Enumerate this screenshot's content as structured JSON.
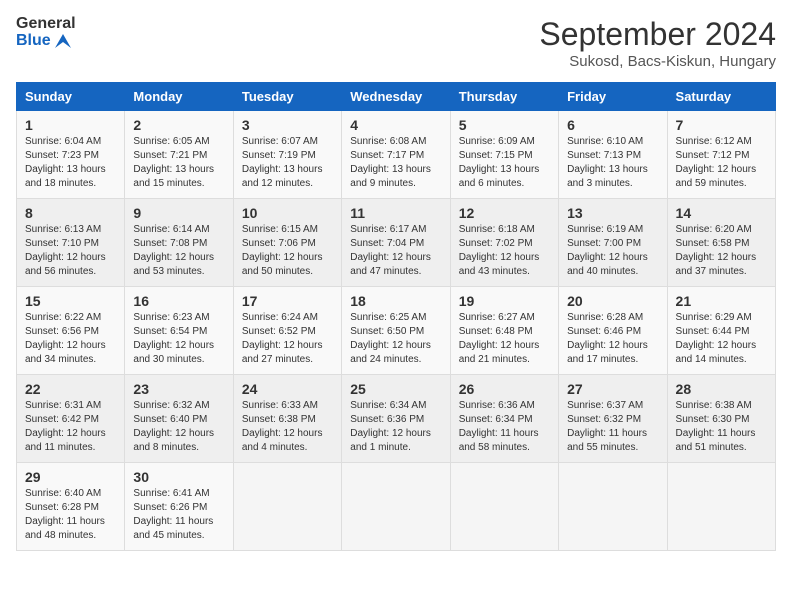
{
  "logo": {
    "line1": "General",
    "line2": "Blue"
  },
  "title": "September 2024",
  "subtitle": "Sukosd, Bacs-Kiskun, Hungary",
  "days_of_week": [
    "Sunday",
    "Monday",
    "Tuesday",
    "Wednesday",
    "Thursday",
    "Friday",
    "Saturday"
  ],
  "weeks": [
    [
      {
        "day": "1",
        "sunrise": "6:04 AM",
        "sunset": "7:23 PM",
        "daylight": "13 hours and 18 minutes."
      },
      {
        "day": "2",
        "sunrise": "6:05 AM",
        "sunset": "7:21 PM",
        "daylight": "13 hours and 15 minutes."
      },
      {
        "day": "3",
        "sunrise": "6:07 AM",
        "sunset": "7:19 PM",
        "daylight": "13 hours and 12 minutes."
      },
      {
        "day": "4",
        "sunrise": "6:08 AM",
        "sunset": "7:17 PM",
        "daylight": "13 hours and 9 minutes."
      },
      {
        "day": "5",
        "sunrise": "6:09 AM",
        "sunset": "7:15 PM",
        "daylight": "13 hours and 6 minutes."
      },
      {
        "day": "6",
        "sunrise": "6:10 AM",
        "sunset": "7:13 PM",
        "daylight": "13 hours and 3 minutes."
      },
      {
        "day": "7",
        "sunrise": "6:12 AM",
        "sunset": "7:12 PM",
        "daylight": "12 hours and 59 minutes."
      }
    ],
    [
      {
        "day": "8",
        "sunrise": "6:13 AM",
        "sunset": "7:10 PM",
        "daylight": "12 hours and 56 minutes."
      },
      {
        "day": "9",
        "sunrise": "6:14 AM",
        "sunset": "7:08 PM",
        "daylight": "12 hours and 53 minutes."
      },
      {
        "day": "10",
        "sunrise": "6:15 AM",
        "sunset": "7:06 PM",
        "daylight": "12 hours and 50 minutes."
      },
      {
        "day": "11",
        "sunrise": "6:17 AM",
        "sunset": "7:04 PM",
        "daylight": "12 hours and 47 minutes."
      },
      {
        "day": "12",
        "sunrise": "6:18 AM",
        "sunset": "7:02 PM",
        "daylight": "12 hours and 43 minutes."
      },
      {
        "day": "13",
        "sunrise": "6:19 AM",
        "sunset": "7:00 PM",
        "daylight": "12 hours and 40 minutes."
      },
      {
        "day": "14",
        "sunrise": "6:20 AM",
        "sunset": "6:58 PM",
        "daylight": "12 hours and 37 minutes."
      }
    ],
    [
      {
        "day": "15",
        "sunrise": "6:22 AM",
        "sunset": "6:56 PM",
        "daylight": "12 hours and 34 minutes."
      },
      {
        "day": "16",
        "sunrise": "6:23 AM",
        "sunset": "6:54 PM",
        "daylight": "12 hours and 30 minutes."
      },
      {
        "day": "17",
        "sunrise": "6:24 AM",
        "sunset": "6:52 PM",
        "daylight": "12 hours and 27 minutes."
      },
      {
        "day": "18",
        "sunrise": "6:25 AM",
        "sunset": "6:50 PM",
        "daylight": "12 hours and 24 minutes."
      },
      {
        "day": "19",
        "sunrise": "6:27 AM",
        "sunset": "6:48 PM",
        "daylight": "12 hours and 21 minutes."
      },
      {
        "day": "20",
        "sunrise": "6:28 AM",
        "sunset": "6:46 PM",
        "daylight": "12 hours and 17 minutes."
      },
      {
        "day": "21",
        "sunrise": "6:29 AM",
        "sunset": "6:44 PM",
        "daylight": "12 hours and 14 minutes."
      }
    ],
    [
      {
        "day": "22",
        "sunrise": "6:31 AM",
        "sunset": "6:42 PM",
        "daylight": "12 hours and 11 minutes."
      },
      {
        "day": "23",
        "sunrise": "6:32 AM",
        "sunset": "6:40 PM",
        "daylight": "12 hours and 8 minutes."
      },
      {
        "day": "24",
        "sunrise": "6:33 AM",
        "sunset": "6:38 PM",
        "daylight": "12 hours and 4 minutes."
      },
      {
        "day": "25",
        "sunrise": "6:34 AM",
        "sunset": "6:36 PM",
        "daylight": "12 hours and 1 minute."
      },
      {
        "day": "26",
        "sunrise": "6:36 AM",
        "sunset": "6:34 PM",
        "daylight": "11 hours and 58 minutes."
      },
      {
        "day": "27",
        "sunrise": "6:37 AM",
        "sunset": "6:32 PM",
        "daylight": "11 hours and 55 minutes."
      },
      {
        "day": "28",
        "sunrise": "6:38 AM",
        "sunset": "6:30 PM",
        "daylight": "11 hours and 51 minutes."
      }
    ],
    [
      {
        "day": "29",
        "sunrise": "6:40 AM",
        "sunset": "6:28 PM",
        "daylight": "11 hours and 48 minutes."
      },
      {
        "day": "30",
        "sunrise": "6:41 AM",
        "sunset": "6:26 PM",
        "daylight": "11 hours and 45 minutes."
      },
      null,
      null,
      null,
      null,
      null
    ]
  ]
}
